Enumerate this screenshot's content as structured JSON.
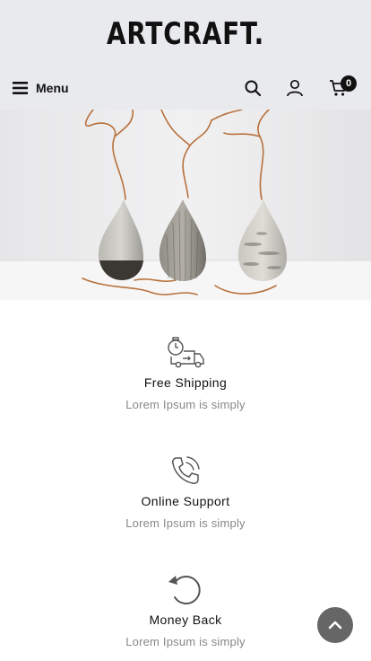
{
  "header": {
    "logo": "ARTCRAFT.",
    "menu_label": "Menu",
    "cart_count": "0",
    "icons": [
      "hamburger-icon",
      "search-icon",
      "user-icon",
      "cart-icon"
    ],
    "background": "#e9eaed"
  },
  "hero": {
    "image": "three-ceramic-vases-with-dry-branches"
  },
  "features": [
    {
      "title": "Free Shipping",
      "text": "Lorem Ipsum is simply",
      "icon": "delivery-truck-icon"
    },
    {
      "title": "Online Support",
      "text": "Lorem Ipsum is simply",
      "icon": "phone-icon"
    },
    {
      "title": "Money Back",
      "text": "Lorem Ipsum is simply",
      "icon": "refund-arrow-icon"
    }
  ],
  "back_to_top": {
    "icon": "chevron-up-icon",
    "color": "#666666"
  }
}
